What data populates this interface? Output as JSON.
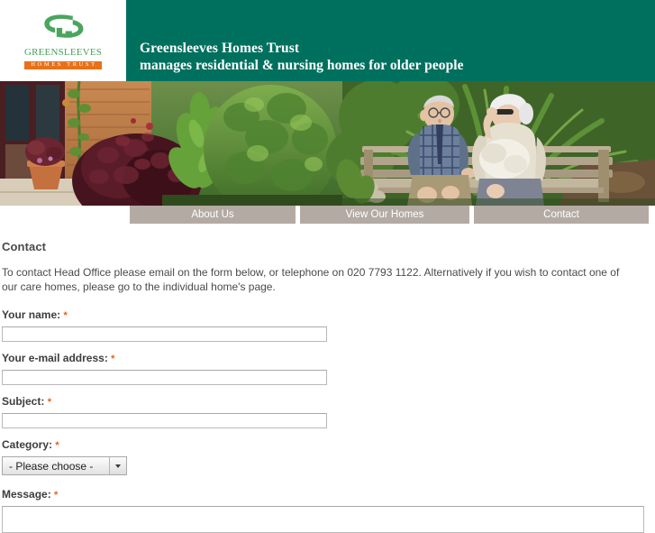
{
  "header": {
    "logo": {
      "mark_icon": "greensleeves-swirl-icon",
      "wordmark": "Greensleeves",
      "subtitle": "HOMES TRUST"
    },
    "title_line1": "Greensleeves Homes Trust",
    "title_line2": "manages residential & nursing homes for older people",
    "background_color": "#00705e",
    "accent_orange": "#e8711a",
    "logo_green": "#46a05a"
  },
  "hero": {
    "alt": "Garden with elderly couple seated on a wooden bench",
    "image_name": "garden-couple-bench-photo"
  },
  "nav": {
    "items": [
      {
        "label": "About Us",
        "name": "nav-about-us"
      },
      {
        "label": "View Our Homes",
        "name": "nav-view-our-homes"
      },
      {
        "label": "Contact",
        "name": "nav-contact"
      }
    ],
    "button_color": "#b4aaa4"
  },
  "main": {
    "title": "Contact",
    "intro": "To contact Head Office please email on the form below, or telephone on 020 7793 1122. Alternatively if you wish to contact one of our care homes, please go to the individual home's page.",
    "required_marker": "*",
    "fields": [
      {
        "label": "Your name:",
        "value": "",
        "placeholder": ""
      },
      {
        "label": "Your e-mail address:",
        "value": "",
        "placeholder": ""
      },
      {
        "label": "Subject:",
        "value": "",
        "placeholder": ""
      },
      {
        "label": "Category:",
        "selected": "- Please choose -"
      },
      {
        "label": "Message:",
        "value": "",
        "placeholder": ""
      }
    ]
  }
}
